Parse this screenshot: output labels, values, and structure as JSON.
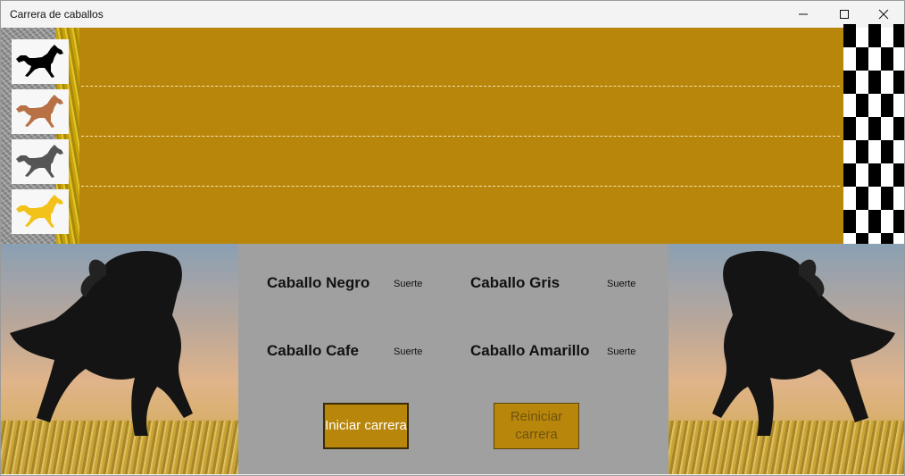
{
  "window": {
    "title": "Carrera de caballos"
  },
  "colors": {
    "track": "#b8860b",
    "panel": "#a0a0a0",
    "button": "#b8860b"
  },
  "horses": [
    {
      "name": "black",
      "icon": "horse-black-icon",
      "color": "#000000"
    },
    {
      "name": "brown",
      "icon": "horse-brown-icon",
      "color": "#b87045"
    },
    {
      "name": "gray",
      "icon": "horse-gray-icon",
      "color": "#555555"
    },
    {
      "name": "yellow",
      "icon": "horse-yellow-icon",
      "color": "#f2c21a"
    }
  ],
  "panel": {
    "negro": {
      "label": "Caballo Negro",
      "suerte": "Suerte"
    },
    "gris": {
      "label": "Caballo Gris",
      "suerte": "Suerte"
    },
    "cafe": {
      "label": "Caballo Cafe",
      "suerte": "Suerte"
    },
    "amarillo": {
      "label": "Caballo Amarillo",
      "suerte": "Suerte"
    },
    "start_button": "Iniciar carrera",
    "reset_button": "Reiniciar carrera"
  }
}
